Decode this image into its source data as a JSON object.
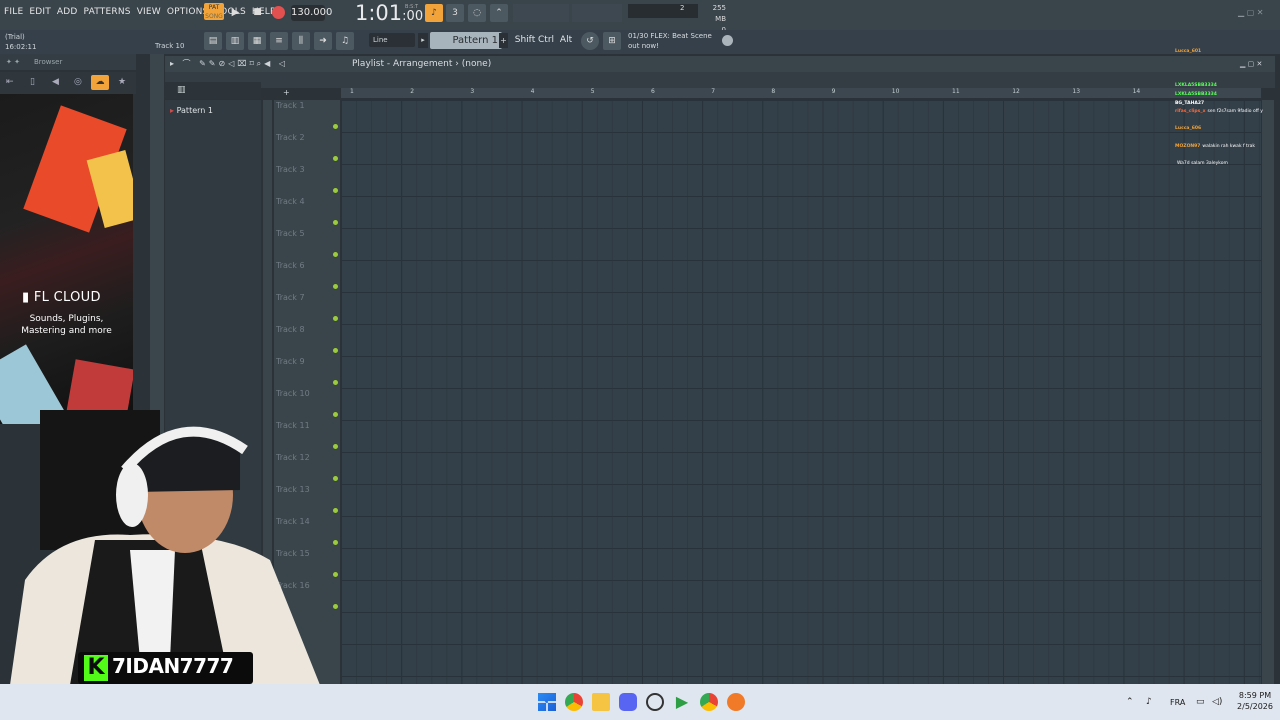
{
  "menu": [
    "FILE",
    "EDIT",
    "ADD",
    "PATTERNS",
    "VIEW",
    "OPTIONS",
    "TOOLS",
    "HELP"
  ],
  "transport": {
    "pat_label": "PAT",
    "song_label": "SONG",
    "tempo": "130.000",
    "time": "1:01",
    "time_sub": ":00",
    "time_label": "B:S:T"
  },
  "status": {
    "trial": "(Trial)",
    "elapsed": "16:02:11",
    "track_hint": "Track 10"
  },
  "memory": {
    "cpu": "2",
    "mb": "255 MB",
    "voices": "0"
  },
  "toolbar": {
    "snap": "Line",
    "pattern": "Pattern 1",
    "shift": "Shift",
    "ctrl": "Ctrl",
    "alt": "Alt"
  },
  "news": {
    "line1": "01/30  FLEX: Beat Scene",
    "line2": "out now!"
  },
  "browser": {
    "title": "Browser",
    "ad_brand": "FL CLOUD",
    "ad_line1": "Sounds, Plugins,",
    "ad_line2": "Mastering and more"
  },
  "playlist": {
    "title": "Playlist - Arrangement",
    "arrow": "›",
    "sel": "(none)",
    "pattern_item": "Pattern 1"
  },
  "timeline": [
    "1",
    "2",
    "3",
    "4",
    "5",
    "6",
    "7",
    "8",
    "9",
    "10",
    "11",
    "12",
    "13",
    "14"
  ],
  "tracks": [
    "Track 1",
    "Track 2",
    "Track 3",
    "Track 4",
    "Track 5",
    "Track 6",
    "Track 7",
    "Track 8",
    "Track 9",
    "Track 10",
    "Track 11",
    "Track 12",
    "Track 13",
    "Track 14",
    "Track 15",
    "Track 16"
  ],
  "chat": [
    {
      "user": "Lucca_601",
      "msg": "",
      "color": "#f2a43a"
    },
    {
      "user": "",
      "msg": "",
      "color": "#3aa0f2"
    },
    {
      "user": "",
      "msg": "",
      "color": "#3aa0f2"
    },
    {
      "user": "",
      "msg": "",
      "color": "#3aa0f2"
    },
    {
      "user": "LXKLA5SBB3334",
      "msg": "",
      "color": "#5aff5a"
    },
    {
      "user": "LXKLA5SBB3334",
      "msg": "",
      "color": "#5aff5a"
    },
    {
      "user": "BG_TAHA27",
      "msg": "",
      "color": "#ffffff"
    },
    {
      "user": "rifas_clips_x",
      "msg": "sen f2s7sam 9fadio off y",
      "color": "#ff6a3a"
    },
    {
      "user": "",
      "msg": "",
      "color": "#3aa0f2"
    },
    {
      "user": "Lucca_606",
      "msg": "",
      "color": "#f2a43a"
    },
    {
      "user": "",
      "msg": "",
      "color": "#3aa0f2"
    },
    {
      "user": "MOZON97",
      "msg": "walakin rah kwak f trak",
      "color": "#f2a43a"
    },
    {
      "user": "",
      "msg": "",
      "color": "#3aa0f2"
    },
    {
      "user": "",
      "msg": "Wa7d salam 3aleykom",
      "color": "#e04040"
    }
  ],
  "webcam": {
    "k_letter": "K",
    "handle": "7IDAN7777"
  },
  "taskbar": {
    "lang": "FRA",
    "time": "8:59 PM",
    "date": "2/5/2026"
  }
}
